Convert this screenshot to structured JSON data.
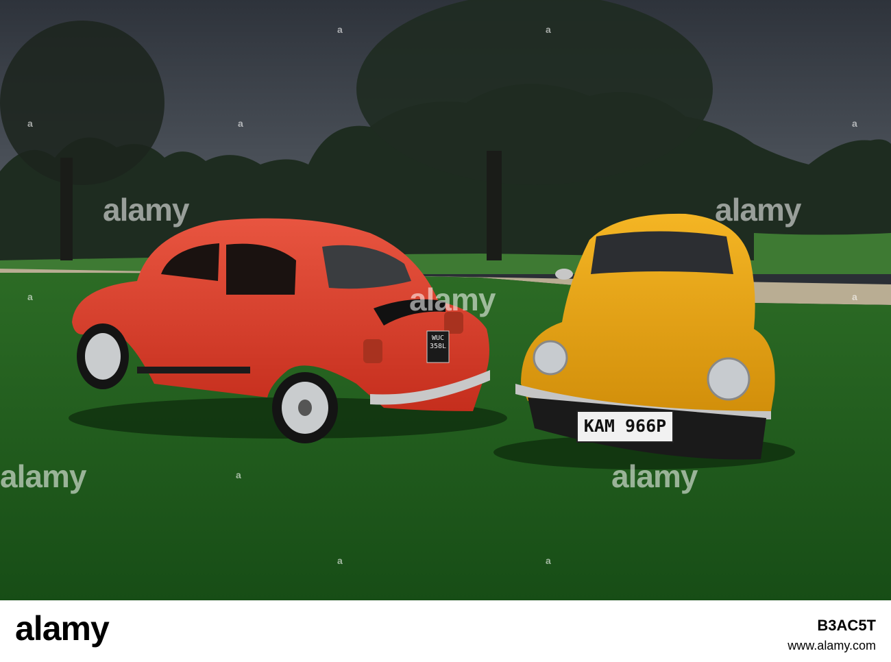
{
  "photo": {
    "colors": {
      "sky": "#3d434d",
      "grass": "#1f5a1c",
      "path": "#b7ab92",
      "red_car": "#e0412c",
      "yellow_car": "#e8a612",
      "tree": "#1d2a1f"
    },
    "plates": {
      "red_car": "WUC 358L",
      "yellow_car": "KAM 966P"
    }
  },
  "watermark": {
    "text": "alamy",
    "dot": "a"
  },
  "footer": {
    "logo": "alamy",
    "image_id": "B3AC5T",
    "url": "www.alamy.com"
  }
}
